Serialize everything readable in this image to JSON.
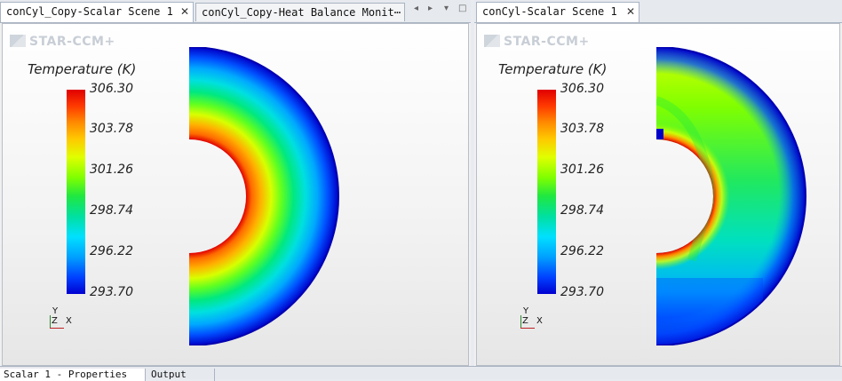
{
  "left_pane": {
    "tabs": [
      {
        "label": "conCyl_Copy-Scalar Scene 1",
        "active": true
      },
      {
        "label": "conCyl_Copy-Heat Balance Monit⋯",
        "active": false
      }
    ],
    "close_symbol": "✕",
    "controls": [
      "◂",
      "▸",
      "▾",
      "□"
    ],
    "logo": "STAR-CCM+",
    "legend": {
      "title": "Temperature (K)",
      "ticks": [
        "306.30",
        "303.78",
        "301.26",
        "298.74",
        "296.22",
        "293.70"
      ]
    },
    "axes": {
      "y": "Y",
      "z": "Z",
      "x": "X"
    }
  },
  "right_pane": {
    "tabs": [
      {
        "label": "conCyl-Scalar Scene 1",
        "active": true
      }
    ],
    "close_symbol": "✕",
    "logo": "STAR-CCM+",
    "legend": {
      "title": "Temperature (K)",
      "ticks": [
        "306.30",
        "303.78",
        "301.26",
        "298.74",
        "296.22",
        "293.70"
      ]
    },
    "axes": {
      "y": "Y",
      "z": "Z",
      "x": "X"
    }
  },
  "bottom_tabs": [
    "Scalar 1 - Properties",
    "Output"
  ],
  "colors": {
    "max": "#e00000",
    "high": "#ff8a00",
    "mid": "#80ff00",
    "low": "#00e0ff",
    "min": "#0000d0"
  }
}
